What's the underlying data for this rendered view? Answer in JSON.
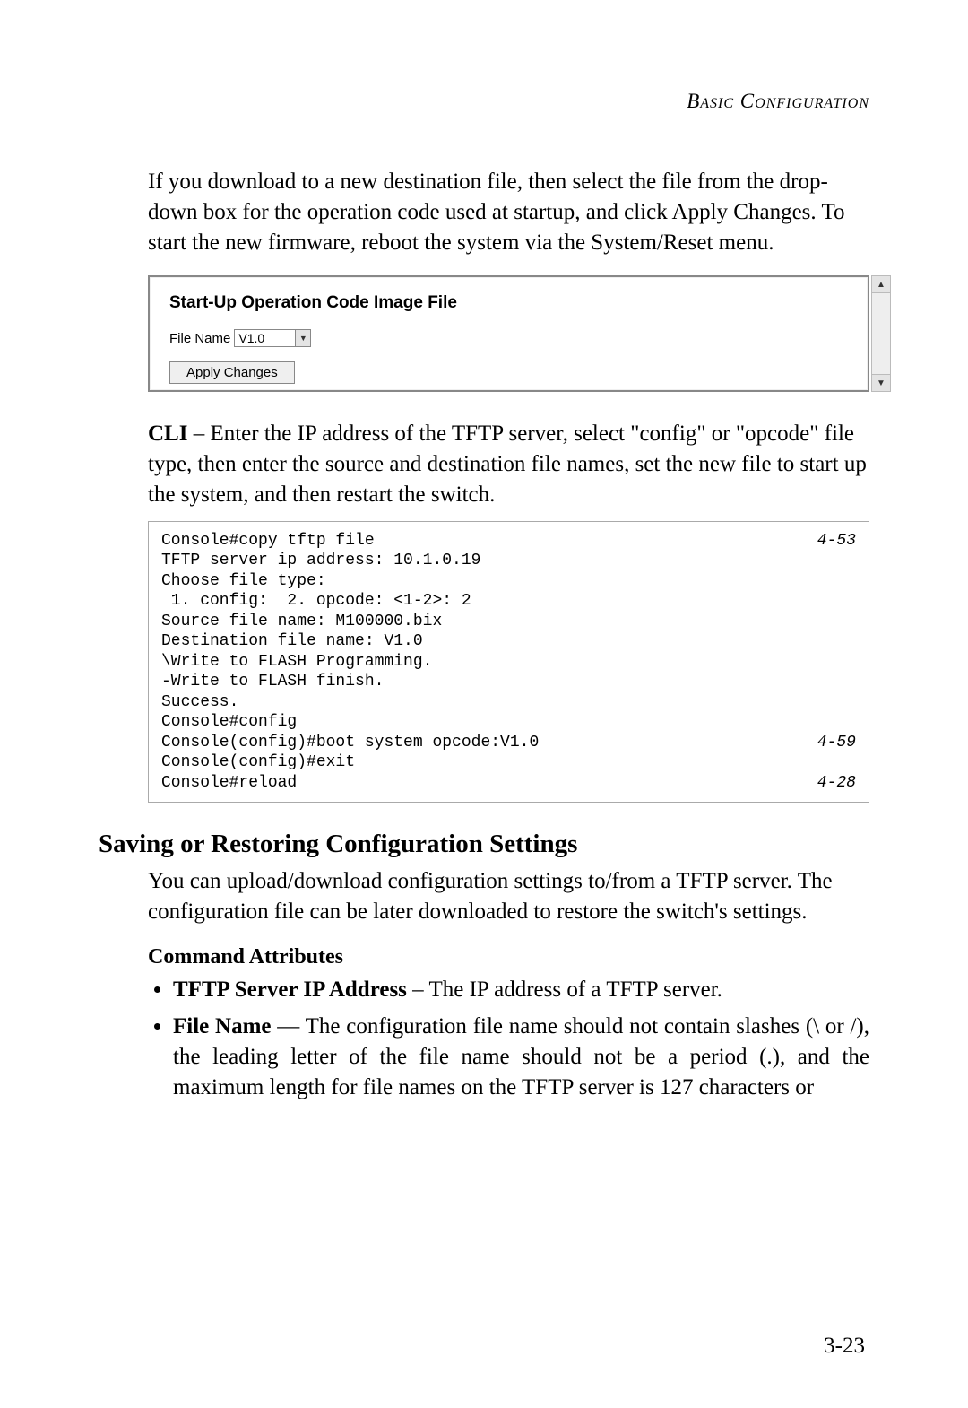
{
  "header": "Basic Configuration",
  "intro_paragraph": " If you download to a new destination file, then select the file from the drop-down box for the operation code used at startup, and click Apply Changes. To start the new firmware, reboot the system via the System/Reset menu.",
  "ui_panel": {
    "title": "Start-Up Operation Code Image File",
    "file_label": "File Name",
    "file_value": "V1.0",
    "apply_button": "Apply Changes"
  },
  "cli_intro_bold": "CLI",
  "cli_intro_rest": " – Enter the IP address of the TFTP server, select \"config\" or \"opcode\" file type, then enter the source and destination file names, set the new file to start up the system, and then restart the switch.",
  "code": {
    "lines": [
      "Console#copy tftp file",
      "TFTP server ip address: 10.1.0.19",
      "Choose file type:",
      " 1. config:  2. opcode: <1-2>: 2",
      "Source file name: M100000.bix",
      "Destination file name: V1.0",
      "\\Write to FLASH Programming.",
      "-Write to FLASH finish.",
      "Success.",
      "Console#config",
      "Console(config)#boot system opcode:V1.0",
      "Console(config)#exit",
      "Console#reload"
    ],
    "refs": {
      "0": "4-53",
      "10": "4-59",
      "12": "4-28"
    }
  },
  "section_heading": "Saving or Restoring Configuration Settings",
  "section_para": "You can upload/download configuration settings to/from a TFTP server. The configuration file can be later downloaded to restore the switch's settings.",
  "command_attributes_heading": "Command Attributes",
  "attrs": [
    {
      "bold": "TFTP Server IP Address",
      "rest": " – The IP address of a TFTP server."
    },
    {
      "bold": "File Name",
      "rest": " — The configuration file name should not contain slashes (\\ or /), the leading letter of the file name should not be a period (.), and the maximum length for file names on the TFTP server is 127 characters or"
    }
  ],
  "page_number": "3-23"
}
